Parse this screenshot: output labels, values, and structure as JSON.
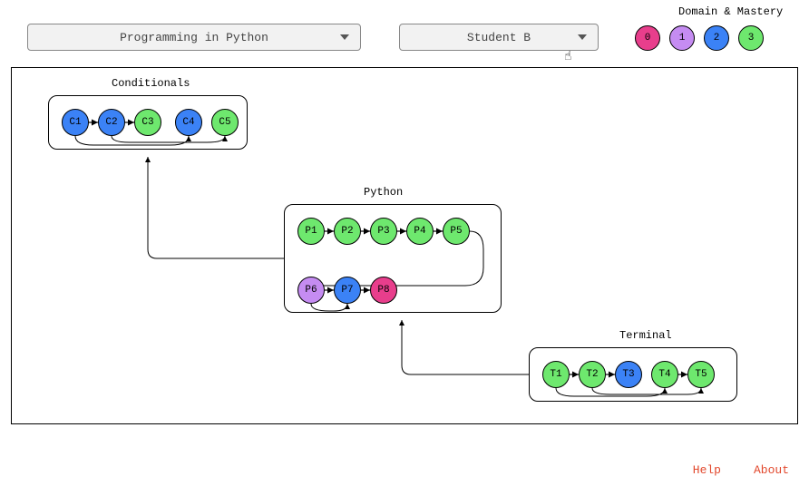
{
  "dropdowns": {
    "course": "Programming in Python",
    "student": "Student B"
  },
  "legend": {
    "title": "Domain & Mastery",
    "levels": [
      {
        "value": "0",
        "color": "#e83e8c"
      },
      {
        "value": "1",
        "color": "#c58cf2"
      },
      {
        "value": "2",
        "color": "#3b82f6"
      },
      {
        "value": "3",
        "color": "#6ee86e"
      }
    ]
  },
  "groups": {
    "conditionals": {
      "title": "Conditionals",
      "nodes": [
        {
          "id": "C1",
          "color": "#3b82f6"
        },
        {
          "id": "C2",
          "color": "#3b82f6"
        },
        {
          "id": "C3",
          "color": "#6ee86e"
        },
        {
          "id": "C4",
          "color": "#3b82f6"
        },
        {
          "id": "C5",
          "color": "#6ee86e"
        }
      ]
    },
    "python": {
      "title": "Python",
      "nodes_top": [
        {
          "id": "P1",
          "color": "#6ee86e"
        },
        {
          "id": "P2",
          "color": "#6ee86e"
        },
        {
          "id": "P3",
          "color": "#6ee86e"
        },
        {
          "id": "P4",
          "color": "#6ee86e"
        },
        {
          "id": "P5",
          "color": "#6ee86e"
        }
      ],
      "nodes_bottom": [
        {
          "id": "P6",
          "color": "#c58cf2"
        },
        {
          "id": "P7",
          "color": "#3b82f6"
        },
        {
          "id": "P8",
          "color": "#e83e8c"
        }
      ]
    },
    "terminal": {
      "title": "Terminal",
      "nodes": [
        {
          "id": "T1",
          "color": "#6ee86e"
        },
        {
          "id": "T2",
          "color": "#6ee86e"
        },
        {
          "id": "T3",
          "color": "#3b82f6"
        },
        {
          "id": "T4",
          "color": "#6ee86e"
        },
        {
          "id": "T5",
          "color": "#6ee86e"
        }
      ]
    }
  },
  "footer": {
    "help": "Help",
    "about": "About"
  }
}
